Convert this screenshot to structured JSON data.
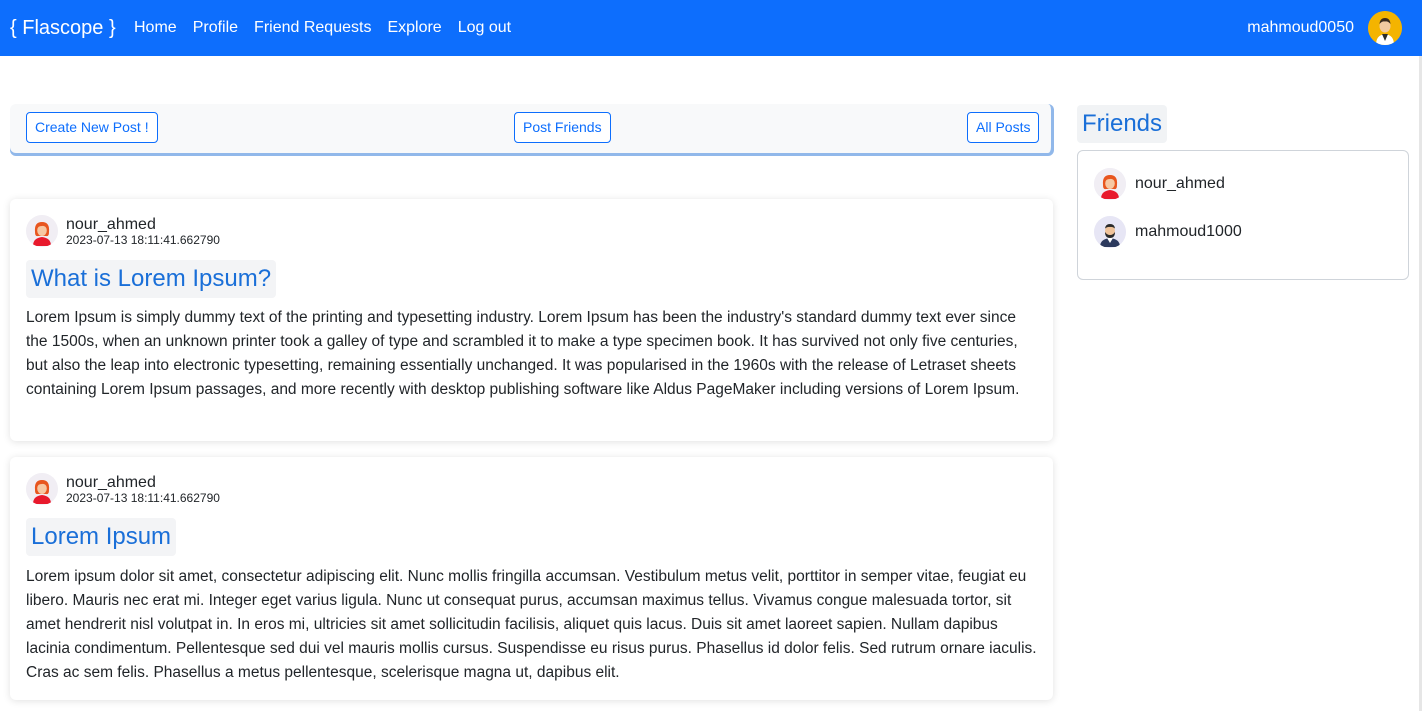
{
  "nav": {
    "brand": "{ Flascope }",
    "links": [
      "Home",
      "Profile",
      "Friend Requests",
      "Explore",
      "Log out"
    ],
    "username": "mahmoud0050"
  },
  "toolbar": {
    "create_label": "Create New Post !",
    "friends_label": "Post Friends",
    "all_label": "All Posts"
  },
  "posts": [
    {
      "author": "nour_ahmed",
      "timestamp": "2023-07-13 18:11:41.662790",
      "title": "What is Lorem Ipsum?",
      "body": "Lorem Ipsum is simply dummy text of the printing and typesetting industry. Lorem Ipsum has been the industry's standard dummy text ever since the 1500s, when an unknown printer took a galley of type and scrambled it to make a type specimen book. It has survived not only five centuries, but also the leap into electronic typesetting, remaining essentially unchanged. It was popularised in the 1960s with the release of Letraset sheets containing Lorem Ipsum passages, and more recently with desktop publishing software like Aldus PageMaker including versions of Lorem Ipsum."
    },
    {
      "author": "nour_ahmed",
      "timestamp": "2023-07-13 18:11:41.662790",
      "title": "Lorem Ipsum",
      "body": "Lorem ipsum dolor sit amet, consectetur adipiscing elit. Nunc mollis fringilla accumsan. Vestibulum metus velit, porttitor in semper vitae, feugiat eu libero. Mauris nec erat mi. Integer eget varius ligula. Nunc ut consequat purus, accumsan maximus tellus. Vivamus congue malesuada tortor, sit amet hendrerit nisl volutpat in. In eros mi, ultricies sit amet sollicitudin facilisis, aliquet quis lacus. Duis sit amet laoreet sapien. Nullam dapibus lacinia condimentum. Pellentesque sed dui vel mauris mollis cursus. Suspendisse eu risus purus. Phasellus id dolor felis. Sed rutrum ornare iaculis. Cras ac sem felis. Phasellus a metus pellentesque, scelerisque magna ut, dapibus elit."
    }
  ],
  "friends": {
    "title": "Friends",
    "items": [
      {
        "name": "nour_ahmed",
        "avatar": "female-avatar-icon"
      },
      {
        "name": "mahmoud1000",
        "avatar": "male-avatar-icon"
      }
    ]
  },
  "colors": {
    "primary": "#0d6efd",
    "heading_blue": "#1a6fd8"
  }
}
